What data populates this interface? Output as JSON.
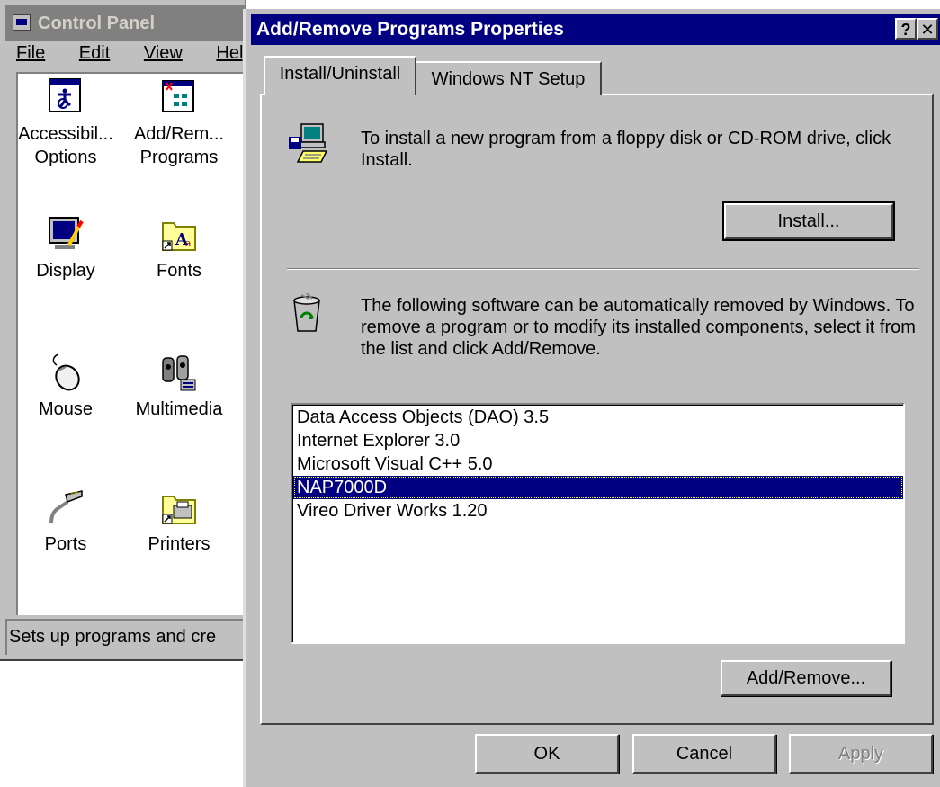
{
  "control_panel": {
    "title": "Control Panel",
    "menu": [
      {
        "label": "File"
      },
      {
        "label": "Edit"
      },
      {
        "label": "View"
      },
      {
        "label": "Help"
      }
    ],
    "items": [
      {
        "label": "Accessibil... Options",
        "icon": "accessibility-icon"
      },
      {
        "label": "Add/Rem... Programs",
        "icon": "add-remove-programs-icon"
      },
      {
        "label": "Display",
        "icon": "display-icon"
      },
      {
        "label": "Fonts",
        "icon": "fonts-icon"
      },
      {
        "label": "Mouse",
        "icon": "mouse-icon"
      },
      {
        "label": "Multimedia",
        "icon": "multimedia-icon"
      },
      {
        "label": "Ports",
        "icon": "ports-icon"
      },
      {
        "label": "Printers",
        "icon": "printers-icon"
      }
    ],
    "status": "Sets up programs and cre"
  },
  "dialog": {
    "title": "Add/Remove Programs Properties",
    "title_buttons": {
      "help": "?",
      "close": "✕"
    },
    "tabs": [
      {
        "label": "Install/Uninstall",
        "active": true
      },
      {
        "label": "Windows NT Setup",
        "active": false
      }
    ],
    "install_text": "To install a new program from a floppy disk or CD-ROM drive, click Install.",
    "install_button": "Install...",
    "remove_text": "The following software can be automatically removed by Windows. To remove a program or to modify its installed components, select it from the list and click Add/Remove.",
    "programs": [
      {
        "name": "Data Access Objects (DAO) 3.5",
        "selected": false
      },
      {
        "name": "Internet Explorer 3.0",
        "selected": false
      },
      {
        "name": "Microsoft Visual C++ 5.0",
        "selected": false
      },
      {
        "name": "NAP7000D",
        "selected": true
      },
      {
        "name": "Vireo Driver Works 1.20",
        "selected": false
      }
    ],
    "add_remove_button": "Add/Remove...",
    "ok_button": "OK",
    "cancel_button": "Cancel",
    "apply_button": "Apply"
  },
  "colors": {
    "face": "#c0c0c0",
    "title_active": "#000080",
    "title_inactive": "#808080",
    "selection": "#000080"
  }
}
